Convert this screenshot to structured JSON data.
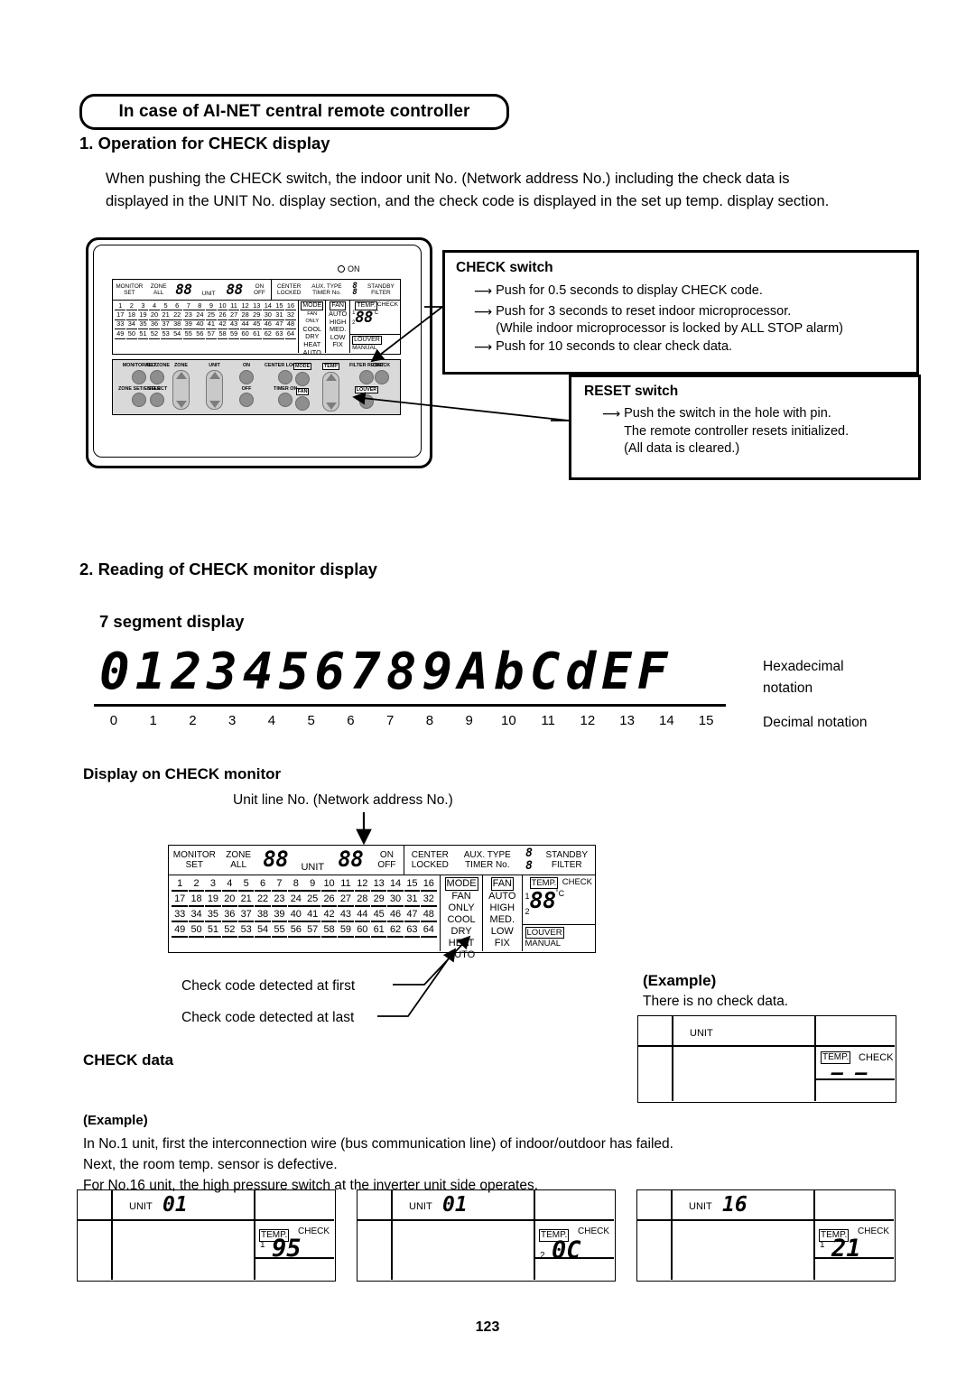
{
  "header": {
    "title": "In case of AI-NET central remote controller",
    "section1_heading": "1. Operation for CHECK display",
    "section1_body_l1": "When pushing the CHECK switch, the indoor unit No. (Network address No.) including the check data is",
    "section1_body_l2": "displayed in the UNIT No. display section, and the check code is displayed in the set up temp. display section."
  },
  "controller": {
    "on_led_label": "ON",
    "lcd": {
      "monitor": "MONITOR",
      "set": "SET",
      "zone": "ZONE",
      "all": "ALL",
      "zone_digits": "88",
      "unit": "UNIT",
      "unit_digits": "88",
      "on": "ON",
      "off": "OFF",
      "center": "CENTER",
      "locked": "LOCKED",
      "aux_type": "AUX. TYPE",
      "timer_no": "TIMER No.",
      "aux_digit": "8",
      "timer_digit": "8",
      "standby": "STANDBY",
      "filter": "FILTER",
      "numbers": [
        [
          "1",
          "2",
          "3",
          "4",
          "5",
          "6",
          "7",
          "8",
          "9",
          "10",
          "11",
          "12",
          "13",
          "14",
          "15",
          "16"
        ],
        [
          "17",
          "18",
          "19",
          "20",
          "21",
          "22",
          "23",
          "24",
          "25",
          "26",
          "27",
          "28",
          "29",
          "30",
          "31",
          "32"
        ],
        [
          "33",
          "34",
          "35",
          "36",
          "37",
          "38",
          "39",
          "40",
          "41",
          "42",
          "43",
          "44",
          "45",
          "46",
          "47",
          "48"
        ],
        [
          "49",
          "50",
          "51",
          "52",
          "53",
          "54",
          "55",
          "56",
          "57",
          "58",
          "59",
          "60",
          "61",
          "62",
          "63",
          "64"
        ]
      ],
      "mode_col": [
        "MODE",
        "FAN ONLY",
        "COOL",
        "DRY",
        "HEAT",
        "AUTO"
      ],
      "fan_col": [
        "FAN",
        "AUTO",
        "HIGH",
        "MED.",
        "LOW",
        "FIX"
      ],
      "temp_label": "TEMP.",
      "check_label": "CHECK",
      "line1": "1",
      "line2": "2",
      "temp_digits": "88",
      "degree": "˚C",
      "louver": "LOUVER",
      "manual": "MANUAL"
    },
    "keypad": {
      "row_top": [
        "MONITOR/SET",
        "ALL/ZONE",
        "ZONE",
        "UNIT",
        "ON",
        "CENTER LOCKED",
        "MODE",
        "TEMP",
        "FILTER RESET",
        "CHECK"
      ],
      "row_bottom": [
        "ZONE SET/ENTER",
        "SELECT",
        "",
        "",
        "OFF",
        "TIMER ON",
        "FAN",
        "",
        "LOUVER",
        ""
      ]
    }
  },
  "check_switch_box": {
    "title": "CHECK switch",
    "lines": [
      "Push for 0.5 seconds to display CHECK code.",
      "Push for 3 seconds to reset indoor microprocessor.",
      "(While indoor microprocessor is locked by ALL STOP alarm)",
      "Push for 10 seconds to clear check data."
    ]
  },
  "reset_switch_box": {
    "title": "RESET switch",
    "lines": [
      "Push the switch in the hole with pin.",
      "The remote controller resets initialized.",
      "(All data is cleared.)"
    ]
  },
  "section2": {
    "heading": "2. Reading of CHECK monitor display",
    "sub_heading": "7 segment display",
    "hex_chars": [
      "0",
      "1",
      "2",
      "3",
      "4",
      "5",
      "6",
      "7",
      "8",
      "9",
      "A",
      "b",
      "C",
      "d",
      "E",
      "F"
    ],
    "hex_label_l1": "Hexadecimal",
    "hex_label_l2": "notation",
    "dec_values": [
      "0",
      "1",
      "2",
      "3",
      "4",
      "5",
      "6",
      "7",
      "8",
      "9",
      "10",
      "11",
      "12",
      "13",
      "14",
      "15"
    ],
    "dec_label": "Decimal notation"
  },
  "monitor_display": {
    "heading": "Display on CHECK monitor",
    "callout_top": "Unit line No. (Network address No.)",
    "callout_first": "Check code detected at first",
    "callout_last": "Check code detected at last"
  },
  "example_no_data": {
    "title": "(Example)",
    "text": "There is no check data.",
    "unit_label": "UNIT",
    "unit_value": "",
    "temp_label": "TEMP.",
    "check_label": "CHECK",
    "code": "– –",
    "line_no": ""
  },
  "check_data": {
    "heading": "CHECK data",
    "example_title": "(Example)",
    "lines": [
      "In No.1 unit, first the interconnection wire (bus communication line) of indoor/outdoor has failed.",
      "Next, the room temp. sensor is defective.",
      "For No.16 unit, the high pressure switch at the inverter unit side operates."
    ],
    "panels": [
      {
        "unit_label": "UNIT",
        "unit_value": "01",
        "temp_label": "TEMP.",
        "check_label": "CHECK",
        "line_no": "1",
        "code": "95"
      },
      {
        "unit_label": "UNIT",
        "unit_value": "01",
        "temp_label": "TEMP.",
        "check_label": "CHECK",
        "line_no": "2",
        "code": "0C"
      },
      {
        "unit_label": "UNIT",
        "unit_value": "16",
        "temp_label": "TEMP.",
        "check_label": "CHECK",
        "line_no": "1",
        "code": "21"
      }
    ]
  },
  "footer": {
    "page_number": "123"
  }
}
